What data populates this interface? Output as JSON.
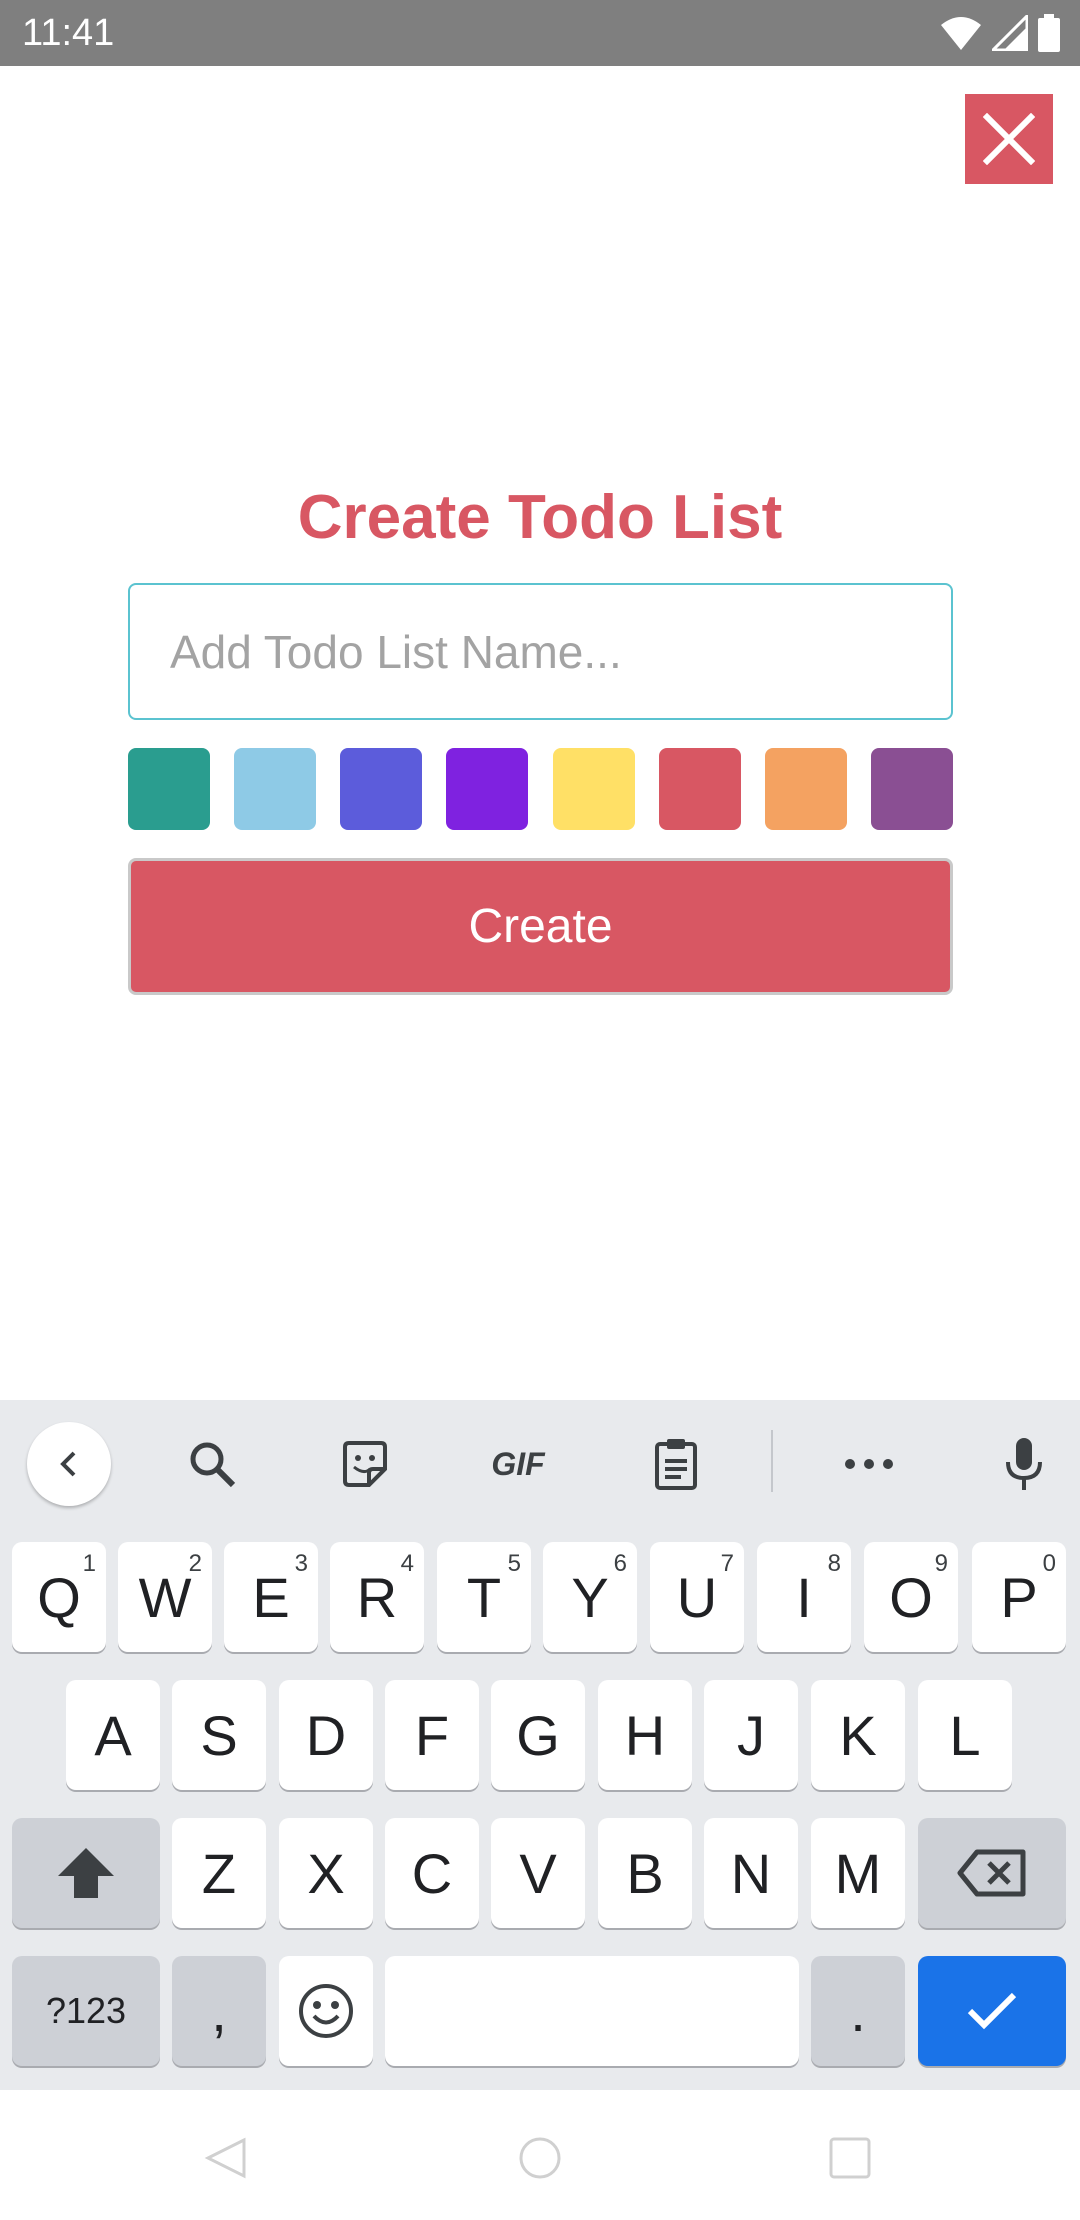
{
  "status_bar": {
    "time": "11:41",
    "icons": [
      "wifi-icon",
      "signal-icon",
      "battery-icon"
    ]
  },
  "close_icon": "close-icon",
  "title": "Create Todo List",
  "input": {
    "placeholder": "Add Todo List Name...",
    "value": ""
  },
  "swatches": [
    "#2a9d8f",
    "#8ecae6",
    "#5c5cdb",
    "#7f22e0",
    "#ffe066",
    "#d85763",
    "#f4a261",
    "#8a4f93"
  ],
  "create_label": "Create",
  "colors": {
    "accent": "#d85763",
    "input_border": "#5bc3d0",
    "enter_key": "#1a73e8"
  },
  "keyboard": {
    "toolbar": [
      "back-icon",
      "search-icon",
      "sticker-icon",
      "GIF",
      "clipboard-icon",
      "more-icon",
      "mic-icon"
    ],
    "row1": [
      {
        "label": "Q",
        "hint": "1"
      },
      {
        "label": "W",
        "hint": "2"
      },
      {
        "label": "E",
        "hint": "3"
      },
      {
        "label": "R",
        "hint": "4"
      },
      {
        "label": "T",
        "hint": "5"
      },
      {
        "label": "Y",
        "hint": "6"
      },
      {
        "label": "U",
        "hint": "7"
      },
      {
        "label": "I",
        "hint": "8"
      },
      {
        "label": "O",
        "hint": "9"
      },
      {
        "label": "P",
        "hint": "0"
      }
    ],
    "row2": [
      "A",
      "S",
      "D",
      "F",
      "G",
      "H",
      "J",
      "K",
      "L"
    ],
    "row3": [
      "Z",
      "X",
      "C",
      "V",
      "B",
      "N",
      "M"
    ],
    "symbols_label": "?123",
    "comma_label": ",",
    "period_label": ".",
    "shift_icon": "shift-icon",
    "backspace_icon": "backspace-icon",
    "emoji_icon": "emoji-icon",
    "enter_icon": "checkmark-icon"
  },
  "nav_bar": [
    "back-triangle-icon",
    "home-circle-icon",
    "recents-square-icon"
  ]
}
